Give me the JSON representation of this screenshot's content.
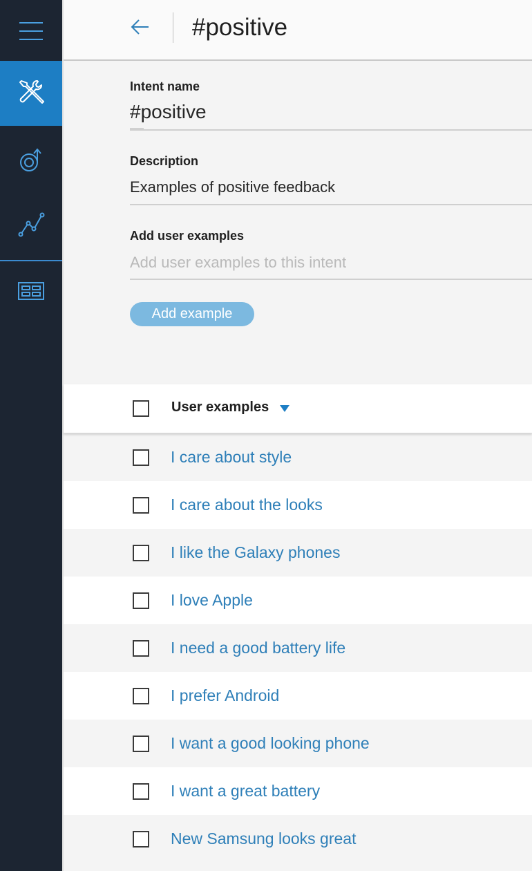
{
  "sidebar": {
    "items": [
      {
        "name": "menu",
        "icon": "hamburger-menu-icon"
      },
      {
        "name": "build",
        "icon": "tools-icon",
        "active": true
      },
      {
        "name": "improve",
        "icon": "improve-cycle-icon"
      },
      {
        "name": "analytics",
        "icon": "line-chart-icon"
      },
      {
        "name": "deploy",
        "icon": "dashboard-grid-icon"
      }
    ]
  },
  "header": {
    "title": "#positive",
    "back_icon": "back-arrow-icon"
  },
  "form": {
    "intent_name_label": "Intent name",
    "intent_name_value": "#positive",
    "description_label": "Description",
    "description_value": "Examples of positive feedback",
    "examples_label": "Add user examples",
    "examples_placeholder": "Add user examples to this intent",
    "add_button_label": "Add example"
  },
  "table": {
    "column_title": "User examples",
    "rows": [
      "I care about style",
      "I care about the looks",
      "I like the Galaxy phones",
      "I love Apple",
      "I need a good battery life",
      "I prefer Android",
      "I want a good looking phone",
      "I want a great battery",
      "New Samsung looks great"
    ]
  },
  "colors": {
    "sidebar_bg": "#1c2532",
    "accent": "#1d7ec4",
    "link": "#2e7fb8",
    "button_bg": "#7cb9e0"
  }
}
